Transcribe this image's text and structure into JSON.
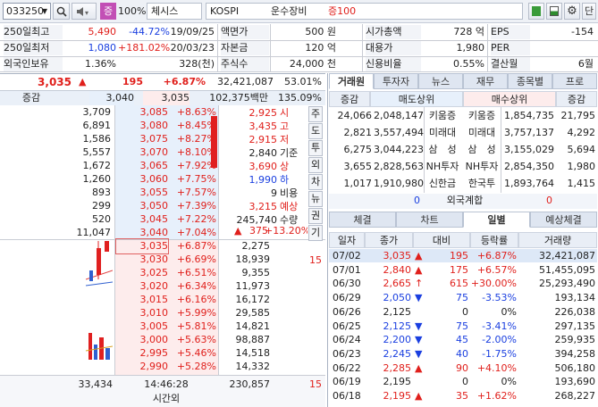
{
  "toolbar": {
    "code": "033250",
    "zoom": "100%",
    "name": "체시스",
    "market": "KOSPI",
    "sector": "운수장비",
    "margin": "증100",
    "side_button": "단"
  },
  "info": {
    "rows": [
      [
        "250일최고",
        "5,490",
        "-44.72%",
        "19/09/25",
        "액면가",
        "500 원",
        "시가총액",
        "728 억",
        "EPS",
        "-154"
      ],
      [
        "250일최저",
        "1,080",
        "+181.02%",
        "20/03/23",
        "자본금",
        "120 억",
        "대용가",
        "1,980",
        "PER",
        ""
      ],
      [
        "외국인보유",
        "1.36%",
        "",
        "328(천)",
        "주식수",
        "24,000 천",
        "신용비율",
        "0.55%",
        "결산월",
        "6월"
      ]
    ]
  },
  "quote": {
    "price": "3,035",
    "arrow": "▲",
    "change": "195",
    "rate": "+6.87%",
    "volume": "32,421,087",
    "turnover": "53.01%",
    "sub_label": "증감",
    "sub_ask": "3,040",
    "sub_bid": "3,035",
    "sub_amount": "102,375백만",
    "sub_ratio": "135.09%"
  },
  "asks": [
    {
      "qty": "3,709",
      "price": "3,085",
      "rate": "+8.63%"
    },
    {
      "qty": "6,891",
      "price": "3,080",
      "rate": "+8.45%"
    },
    {
      "qty": "1,586",
      "price": "3,075",
      "rate": "+8.27%"
    },
    {
      "qty": "5,557",
      "price": "3,070",
      "rate": "+8.10%"
    },
    {
      "qty": "1,672",
      "price": "3,065",
      "rate": "+7.92%"
    },
    {
      "qty": "1,260",
      "price": "3,060",
      "rate": "+7.75%"
    },
    {
      "qty": "893",
      "price": "3,055",
      "rate": "+7.57%"
    },
    {
      "qty": "299",
      "price": "3,050",
      "rate": "+7.39%"
    },
    {
      "qty": "520",
      "price": "3,045",
      "rate": "+7.22%"
    },
    {
      "qty": "11,047",
      "price": "3,040",
      "rate": "+7.04%"
    }
  ],
  "bids": [
    {
      "price": "3,035",
      "rate": "+6.87%",
      "qty": "2,275"
    },
    {
      "price": "3,030",
      "rate": "+6.69%",
      "qty": "18,939"
    },
    {
      "price": "3,025",
      "rate": "+6.51%",
      "qty": "9,355"
    },
    {
      "price": "3,020",
      "rate": "+6.34%",
      "qty": "11,973"
    },
    {
      "price": "3,015",
      "rate": "+6.16%",
      "qty": "16,172"
    },
    {
      "price": "3,010",
      "rate": "+5.99%",
      "qty": "29,585"
    },
    {
      "price": "3,005",
      "rate": "+5.81%",
      "qty": "14,821"
    },
    {
      "price": "3,000",
      "rate": "+5.63%",
      "qty": "98,887"
    },
    {
      "price": "2,995",
      "rate": "+5.46%",
      "qty": "14,518"
    },
    {
      "price": "2,990",
      "rate": "+5.28%",
      "qty": "14,332"
    }
  ],
  "summary": [
    {
      "value": "2,925",
      "label": "시"
    },
    {
      "value": "3,435",
      "label": "고"
    },
    {
      "value": "2,915",
      "label": "저"
    },
    {
      "value": "2,840",
      "label": "기준"
    },
    {
      "value": "3,690",
      "label": "상"
    },
    {
      "value": "1,990",
      "label": "하"
    },
    {
      "value": "9",
      "label": "비용"
    },
    {
      "value": "3,215",
      "label": "예상"
    },
    {
      "value": "245,740",
      "label": "수량"
    }
  ],
  "expected": {
    "arrow": "▲",
    "change": "375",
    "rate": "+13.20%"
  },
  "bid_side_15": "15",
  "side_tabs": [
    "주",
    "도",
    "투",
    "외",
    "차",
    "뉴",
    "권",
    "기"
  ],
  "footer": {
    "ask_total": "33,434",
    "time": "14:46:28",
    "bid_total": "230,857",
    "extra": "15",
    "after_hours": "시간외"
  },
  "right_tabs": [
    "거래원",
    "투자자",
    "뉴스",
    "재무",
    "종목별",
    "프로"
  ],
  "broker": {
    "headers": [
      "증감",
      "매도상위",
      "매수상위",
      "증감"
    ],
    "rows": [
      [
        "24,066",
        "2,048,147",
        "키움증",
        "키움증",
        "1,854,735",
        "21,795"
      ],
      [
        "2,821",
        "3,557,494",
        "미래대",
        "미래대",
        "3,757,137",
        "4,292"
      ],
      [
        "6,275",
        "3,044,223",
        "삼　성",
        "삼　성",
        "3,155,029",
        "5,694"
      ],
      [
        "3,655",
        "2,828,563",
        "NH투자",
        "NH투자",
        "2,854,350",
        "1,980"
      ],
      [
        "1,017",
        "1,910,980",
        "신한금",
        "한국투",
        "1,893,764",
        "1,415"
      ]
    ],
    "foreign": [
      "0",
      "외국계합",
      "0"
    ]
  },
  "lower_tabs": [
    "체결",
    "차트",
    "일별",
    "예상체결"
  ],
  "daily": {
    "headers": [
      "일자",
      "종가",
      "대비",
      "등락률",
      "거래량"
    ],
    "rows": [
      {
        "date": "07/02",
        "close": "3,035",
        "dir": "up",
        "arrow": "▲",
        "diff": "195",
        "rate": "+6.87%",
        "vol": "32,421,087"
      },
      {
        "date": "07/01",
        "close": "2,840",
        "dir": "up",
        "arrow": "▲",
        "diff": "175",
        "rate": "+6.57%",
        "vol": "51,455,095"
      },
      {
        "date": "06/30",
        "close": "2,665",
        "dir": "up",
        "arrow": "↑",
        "diff": "615",
        "rate": "+30.00%",
        "vol": "25,293,490"
      },
      {
        "date": "06/29",
        "close": "2,050",
        "dir": "down",
        "arrow": "▼",
        "diff": "75",
        "rate": "-3.53%",
        "vol": "193,134"
      },
      {
        "date": "06/26",
        "close": "2,125",
        "dir": "flat",
        "arrow": "",
        "diff": "0",
        "rate": "0%",
        "vol": "226,038"
      },
      {
        "date": "06/25",
        "close": "2,125",
        "dir": "down",
        "arrow": "▼",
        "diff": "75",
        "rate": "-3.41%",
        "vol": "297,135"
      },
      {
        "date": "06/24",
        "close": "2,200",
        "dir": "down",
        "arrow": "▼",
        "diff": "45",
        "rate": "-2.00%",
        "vol": "259,935"
      },
      {
        "date": "06/23",
        "close": "2,245",
        "dir": "down",
        "arrow": "▼",
        "diff": "40",
        "rate": "-1.75%",
        "vol": "394,258"
      },
      {
        "date": "06/22",
        "close": "2,285",
        "dir": "up",
        "arrow": "▲",
        "diff": "90",
        "rate": "+4.10%",
        "vol": "506,180"
      },
      {
        "date": "06/19",
        "close": "2,195",
        "dir": "flat",
        "arrow": "",
        "diff": "0",
        "rate": "0%",
        "vol": "193,690"
      },
      {
        "date": "06/18",
        "close": "2,195",
        "dir": "up",
        "arrow": "▲",
        "diff": "35",
        "rate": "+1.62%",
        "vol": "268,227"
      }
    ]
  }
}
